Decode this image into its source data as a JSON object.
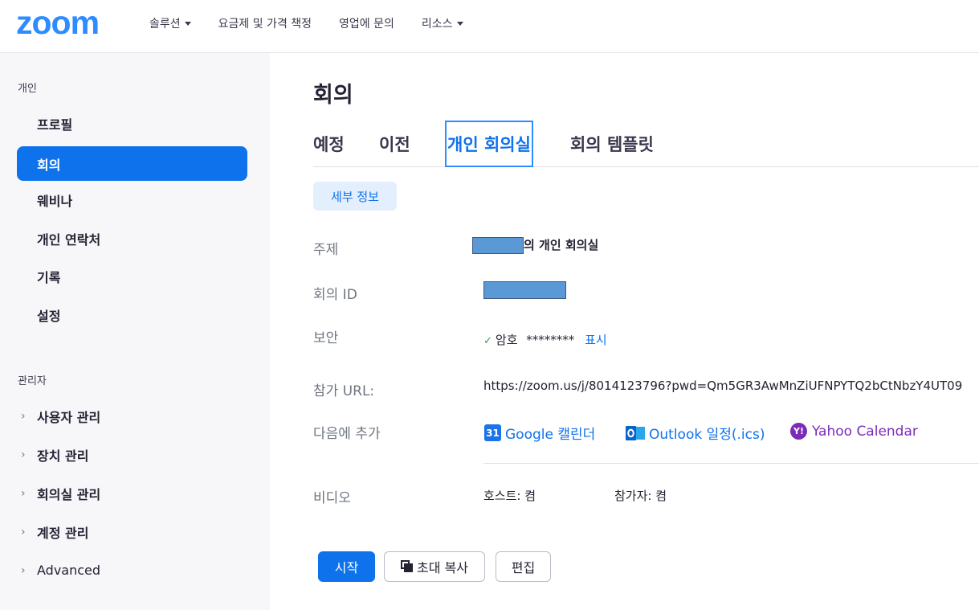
{
  "header": {
    "logo": "zoom",
    "nav": [
      {
        "label": "솔루션",
        "dropdown": true
      },
      {
        "label": "요금제 및 가격 책정",
        "dropdown": false
      },
      {
        "label": "영업에 문의",
        "dropdown": false
      },
      {
        "label": "리소스",
        "dropdown": true
      }
    ]
  },
  "sidebar": {
    "personal_section": "개인",
    "personal_items": [
      {
        "label": "프로필"
      },
      {
        "label": "회의",
        "active": true
      },
      {
        "label": "웨비나"
      },
      {
        "label": "개인 연락처"
      },
      {
        "label": "기록"
      },
      {
        "label": "설정"
      }
    ],
    "admin_section": "관리자",
    "admin_items": [
      {
        "label": "사용자 관리"
      },
      {
        "label": "장치 관리"
      },
      {
        "label": "회의실 관리"
      },
      {
        "label": "계정 관리"
      },
      {
        "label": "Advanced"
      }
    ]
  },
  "main": {
    "title": "회의",
    "tabs": [
      {
        "label": "예정"
      },
      {
        "label": "이전"
      },
      {
        "label": "개인 회의실",
        "active": true
      },
      {
        "label": "회의 템플릿"
      }
    ],
    "detail_button": "세부 정보",
    "fields": {
      "topic_label": "주제",
      "topic_value_suffix": "의 개인 회의실",
      "meeting_id_label": "회의 ID",
      "security_label": "보안",
      "security_value": "암호",
      "security_mask": "********",
      "security_show": "표시",
      "join_url_label": "참가 URL:",
      "join_url_value": "https://zoom.us/j/8014123796?pwd=Qm5GR3AwMnZiUFNPYTQ2bCtNbzY4UT09",
      "add_to_label": "다음에 추가",
      "calendars": {
        "google": "Google 캘린더",
        "google_icon_text": "31",
        "outlook": "Outlook 일정(.ics)",
        "yahoo": "Yahoo Calendar",
        "yahoo_icon_text": "Y!"
      },
      "video_label": "비디오",
      "video_host": "호스트: 켬",
      "video_participant": "참가자: 켬"
    },
    "actions": {
      "start": "시작",
      "copy_invite": "초대 복사",
      "edit": "편집"
    }
  },
  "colors": {
    "brand": "#2D8CFF",
    "accent": "#0E72ED",
    "yahoo": "#7B2BB8",
    "sidebar_bg": "#F7F7FA"
  }
}
